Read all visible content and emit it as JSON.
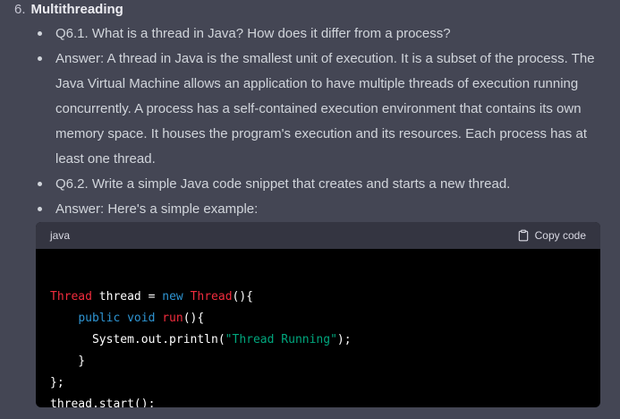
{
  "section": {
    "number": "6.",
    "title": "Multithreading"
  },
  "bullets": [
    {
      "text": "Q6.1. What is a thread in Java? How does it differ from a process?"
    },
    {
      "text": "Answer: A thread in Java is the smallest unit of execution. It is a subset of the process. The Java Virtual Machine allows an application to have multiple threads of execution running concurrently. A process has a self-contained execution environment that contains its own memory space. It houses the program's execution and its resources. Each process has at least one thread."
    },
    {
      "text": "Q6.2. Write a simple Java code snippet that creates and starts a new thread."
    },
    {
      "text": "Answer: Here's a simple example:"
    }
  ],
  "code_block": {
    "language": "java",
    "copy_label": "Copy code",
    "copy_icon": "clipboard-icon",
    "lines": [
      "",
      "Thread thread = new Thread(){",
      "    public void run(){",
      "      System.out.println(\"Thread Running\");",
      "    }",
      "};",
      "thread.start();"
    ]
  },
  "colors": {
    "page_background": "#444654",
    "code_background": "#000000",
    "code_header_background": "#343541",
    "type_token": "#f22c3d",
    "keyword_token": "#2e95d3",
    "string_token": "#00a67d"
  }
}
